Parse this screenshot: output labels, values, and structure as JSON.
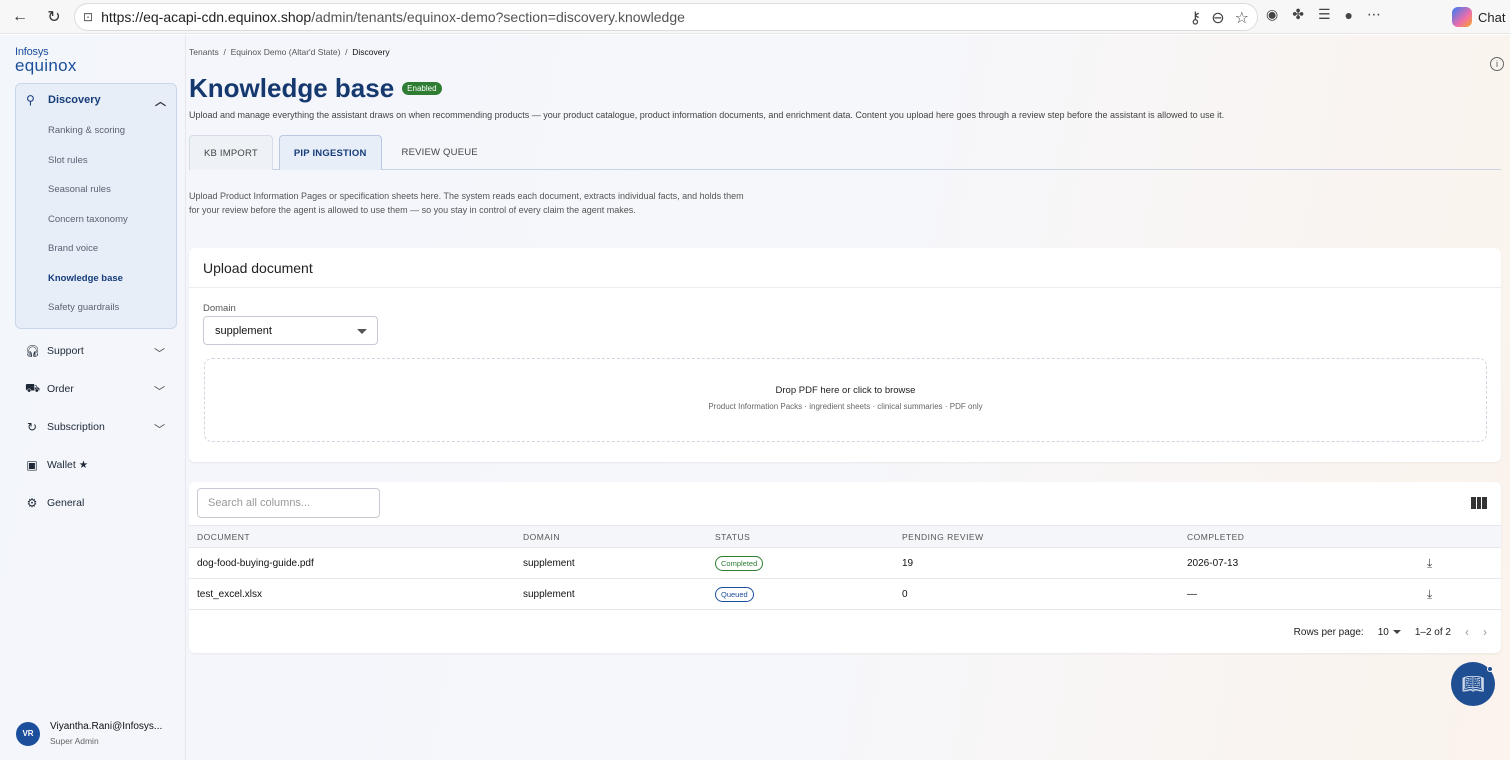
{
  "browser": {
    "url_host": "https://eq-acapi-cdn.equinox.shop",
    "url_path": "/admin/tenants/equinox-demo?section=discovery.knowledge",
    "chat_label": "Chat"
  },
  "logo": {
    "line1": "Infosys",
    "line2": "equinox"
  },
  "sidebar": {
    "group": {
      "label": "Discovery",
      "items": [
        {
          "label": "Ranking & scoring"
        },
        {
          "label": "Slot rules"
        },
        {
          "label": "Seasonal rules"
        },
        {
          "label": "Concern taxonomy"
        },
        {
          "label": "Brand voice"
        },
        {
          "label": "Knowledge base"
        },
        {
          "label": "Safety guardrails"
        }
      ]
    },
    "nav": [
      {
        "label": "Support"
      },
      {
        "label": "Order"
      },
      {
        "label": "Subscription"
      },
      {
        "label": "Wallet ★"
      },
      {
        "label": "General"
      }
    ]
  },
  "user": {
    "initials": "VR",
    "name": "Viyantha.Rani@Infosys...",
    "role": "Super Admin"
  },
  "breadcrumb": {
    "b1": "Tenants",
    "sep": "/",
    "b2": "Equinox Demo (Altar'd State)",
    "b3": "Discovery"
  },
  "page": {
    "title": "Knowledge base",
    "status": "Enabled",
    "subtitle": "Upload and manage everything the assistant draws on when recommending products — your product catalogue, product information documents, and enrichment data. Content you upload here goes through a review step before the assistant is allowed to use it."
  },
  "tabs": [
    {
      "label": "KB IMPORT"
    },
    {
      "label": "PIP INGESTION"
    },
    {
      "label": "REVIEW QUEUE"
    }
  ],
  "description": "Upload Product Information Pages or specification sheets here. The system reads each document, extracts individual facts, and holds them for your review before the agent is allowed to use them — so you stay in control of every claim the agent makes.",
  "upload": {
    "title": "Upload document",
    "domain_label": "Domain",
    "domain_value": "supplement",
    "drop_primary": "Drop PDF here or click to browse",
    "drop_secondary": "Product Information Packs · ingredient sheets · clinical summaries · PDF only"
  },
  "table": {
    "search_placeholder": "Search all columns...",
    "columns": [
      "DOCUMENT",
      "DOMAIN",
      "STATUS",
      "PENDING REVIEW",
      "COMPLETED"
    ],
    "rows": [
      {
        "document": "dog-food-buying-guide.pdf",
        "domain": "supplement",
        "status": "Completed",
        "pending": "19",
        "completed": "2026-07-13"
      },
      {
        "document": "test_excel.xlsx",
        "domain": "supplement",
        "status": "Queued",
        "pending": "0",
        "completed": "—"
      }
    ],
    "rows_per_page_label": "Rows per page:",
    "rows_per_page": "10",
    "range": "1–2 of 2"
  },
  "colors": {
    "brand": "#15396e",
    "enabled": "#2e7d32",
    "queued": "#1b4f9c"
  }
}
